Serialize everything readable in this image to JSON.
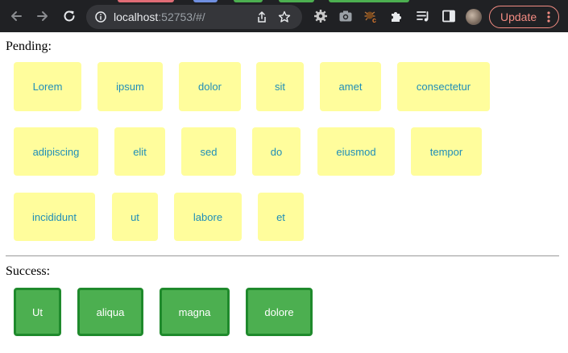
{
  "browser": {
    "url_host": "localhost",
    "url_rest": ":52753/#/",
    "update_label": "Update",
    "colors": {
      "toolbar": "#202124",
      "update_accent": "#f28b82"
    }
  },
  "page": {
    "pending_heading": "Pending:",
    "success_heading": "Success:",
    "pending_items": [
      "Lorem",
      "ipsum",
      "dolor",
      "sit",
      "amet",
      "consectetur",
      "adipiscing",
      "elit",
      "sed",
      "do",
      "eiusmod",
      "tempor",
      "incididunt",
      "ut",
      "labore",
      "et"
    ],
    "success_items": [
      "Ut",
      "aliqua",
      "magna",
      "dolore"
    ],
    "colors": {
      "pending_card": "#fffd9c",
      "pending_text": "#1f8eb8",
      "success_card": "#4caf50",
      "success_border": "#1f8a2c"
    }
  },
  "icons": [
    "back-arrow-icon",
    "forward-arrow-icon",
    "reload-icon",
    "info-icon",
    "share-icon",
    "bookmark-star-icon",
    "gear-extension-icon",
    "camera-extension-icon",
    "bug-extension-icon",
    "puzzle-extensions-icon",
    "reading-list-icon",
    "side-panel-icon",
    "kebab-menu-icon"
  ]
}
